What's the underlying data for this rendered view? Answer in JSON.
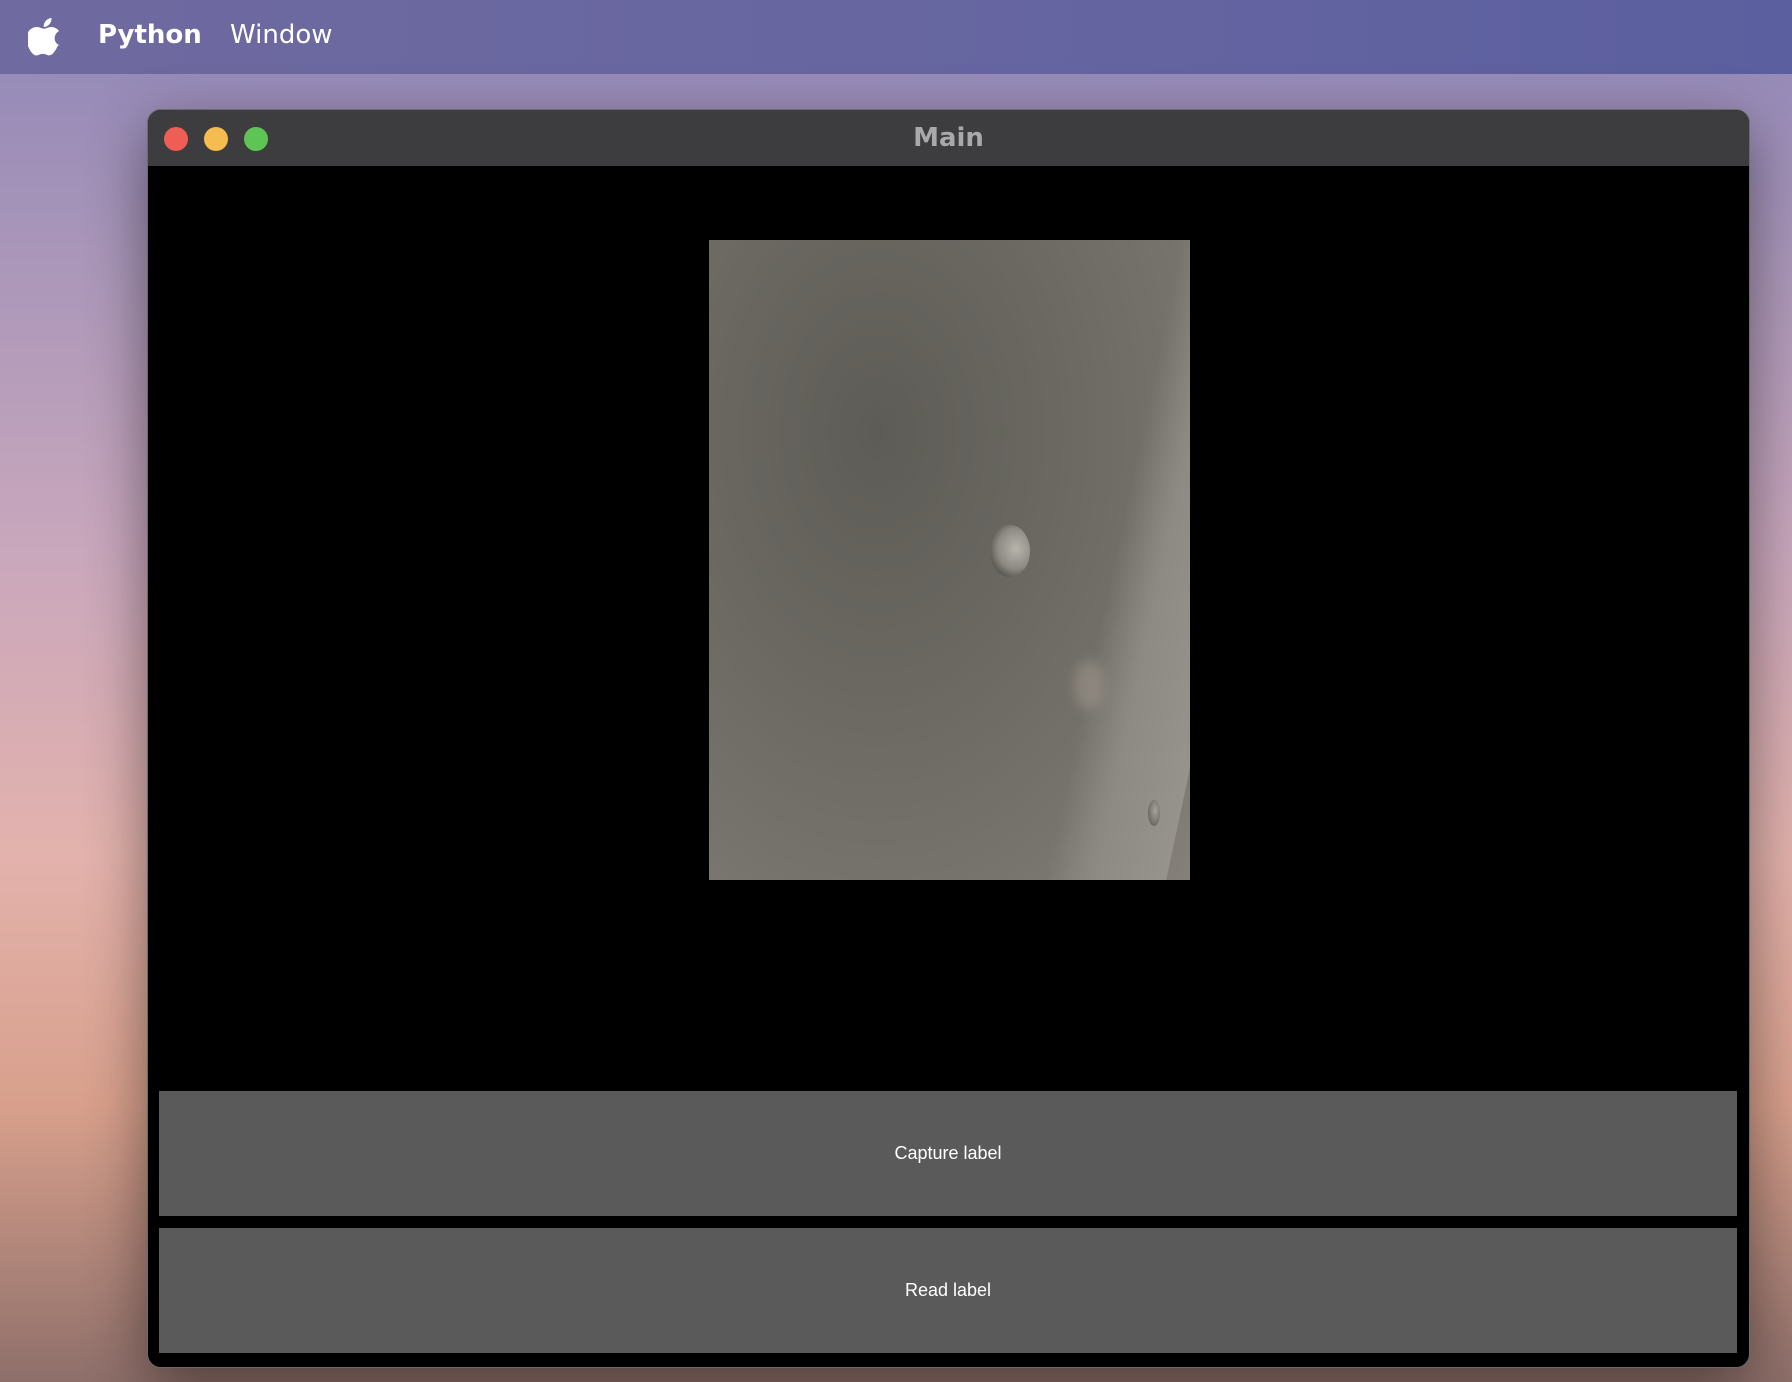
{
  "menubar": {
    "app_name": "Python",
    "items": [
      "Window"
    ]
  },
  "window": {
    "title": "Main",
    "buttons": {
      "capture": "Capture label",
      "read": "Read label"
    }
  },
  "icons": {
    "apple": "apple-logo-icon",
    "traffic_lights": [
      "close-icon",
      "minimize-icon",
      "maximize-icon"
    ]
  },
  "colors": {
    "close": "#ee5e55",
    "minimize": "#f5bd4f",
    "maximize": "#5ec454",
    "button_bg": "#5a5a5a",
    "window_bg": "#000000"
  }
}
